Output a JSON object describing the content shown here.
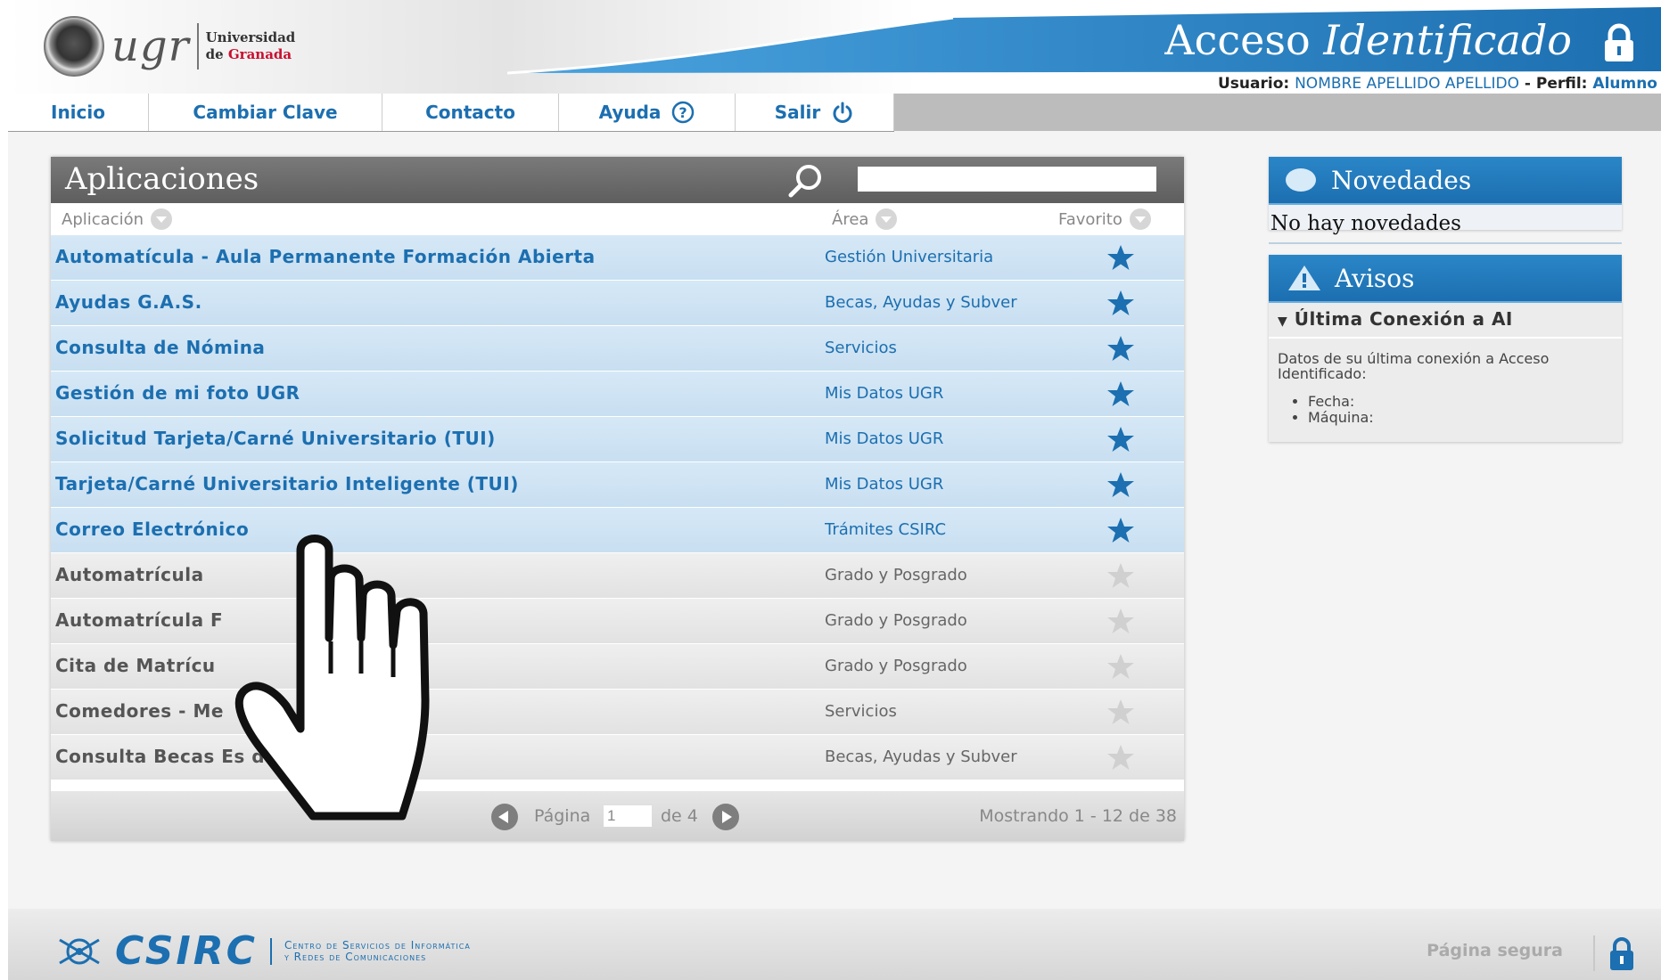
{
  "header": {
    "logo_text": "ugr",
    "university_line1": "Universidad",
    "university_line2_prefix": "de ",
    "university_line2_red": "Granada",
    "title_plain": "Acceso ",
    "title_italic": "Identificado",
    "user_label": "Usuario:",
    "user_name": "NOMBRE APELLIDO APELLIDO",
    "profile_label": "- Perfil:",
    "profile_value": "Alumno",
    "colors": {
      "brand_blue": "#1c6fb0",
      "brand_red": "#c8102e"
    }
  },
  "nav": {
    "items": [
      {
        "label": "Inicio"
      },
      {
        "label": "Cambiar Clave"
      },
      {
        "label": "Contacto"
      },
      {
        "label": "Ayuda",
        "icon": "help-circle-icon"
      },
      {
        "label": "Salir",
        "icon": "power-icon"
      }
    ]
  },
  "apps": {
    "title": "Aplicaciones",
    "search_value": "",
    "columns": {
      "app": "Aplicación",
      "area": "Área",
      "favorite": "Favorito"
    },
    "rows": [
      {
        "app": "Automatícula - Aula Permanente Formación Abierta",
        "area": "Gestión Universitaria",
        "favorite": true
      },
      {
        "app": "Ayudas G.A.S.",
        "area": "Becas, Ayudas y Subver",
        "favorite": true
      },
      {
        "app": "Consulta de Nómina",
        "area": "Servicios",
        "favorite": true
      },
      {
        "app": "Gestión de mi foto UGR",
        "area": "Mis Datos UGR",
        "favorite": true
      },
      {
        "app": "Solicitud Tarjeta/Carné Universitario (TUI)",
        "area": "Mis Datos UGR",
        "favorite": true
      },
      {
        "app": "Tarjeta/Carné Universitario Inteligente (TUI)",
        "area": "Mis Datos UGR",
        "favorite": true
      },
      {
        "app": "Correo Electrónico",
        "area": "Trámites CSIRC",
        "favorite": true
      },
      {
        "app": "Automatrícula",
        "area": "Grado y Posgrado",
        "favorite": false
      },
      {
        "app": "Automatrícula F",
        "area": "Grado y Posgrado",
        "favorite": false
      },
      {
        "app": "Cita de Matrícu",
        "area": "Grado y Posgrado",
        "favorite": false
      },
      {
        "app": "Comedores - Me",
        "area": "Servicios",
        "favorite": false
      },
      {
        "app": "Consulta Becas Es                do",
        "area": "Becas, Ayudas y Subver",
        "favorite": false
      }
    ],
    "pager": {
      "page_label": "Página",
      "current_page": "1",
      "of_label": "de 4",
      "showing": "Mostrando 1 - 12 de 38"
    },
    "colors": {
      "favorite_star": "#1c6fb0",
      "inactive_star": "#d0d0d0"
    }
  },
  "news": {
    "title": "Novedades",
    "body": "No hay novedades"
  },
  "notices": {
    "title": "Avisos",
    "section": "Última Conexión a AI",
    "text": "Datos de su última conexión a Acceso Identificado:",
    "items": [
      "Fecha:",
      "Máquina:"
    ]
  },
  "footer": {
    "logo_word": "CSIRC",
    "logo_sub1": "Centro de Servicios de Informática",
    "logo_sub2": "y Redes de Comunicaciones",
    "secure_label": "Página segura"
  }
}
